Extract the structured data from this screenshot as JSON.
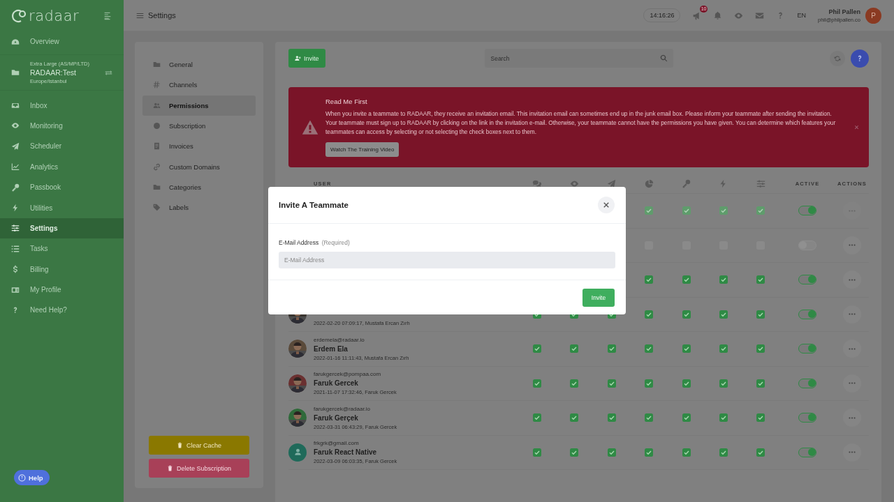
{
  "sidebar": {
    "logo": "radaar",
    "items": [
      {
        "kind": "link",
        "label": "Overview",
        "selected": false
      },
      {
        "kind": "workspace",
        "plan": "Extra Large (AS/MP/LTD)",
        "name": "RADAAR:Test",
        "timezone": "Europe/Istanbul"
      },
      {
        "kind": "link",
        "label": "Inbox",
        "selected": false
      },
      {
        "kind": "link",
        "label": "Monitoring",
        "selected": false
      },
      {
        "kind": "link",
        "label": "Scheduler",
        "selected": false
      },
      {
        "kind": "link",
        "label": "Analytics",
        "selected": false
      },
      {
        "kind": "link",
        "label": "Passbook",
        "selected": false
      },
      {
        "kind": "link",
        "label": "Utilities",
        "selected": false
      },
      {
        "kind": "link",
        "label": "Settings",
        "selected": true
      },
      {
        "kind": "link",
        "label": "Tasks",
        "selected": false
      },
      {
        "kind": "link",
        "label": "Billing",
        "selected": false
      },
      {
        "kind": "link",
        "label": "My Profile",
        "selected": false
      },
      {
        "kind": "link",
        "label": "Need Help?",
        "selected": false
      }
    ]
  },
  "topbar": {
    "title": "Settings",
    "clock": "14:16:26",
    "notification_count": "10",
    "language": "EN",
    "user": {
      "name": "Phil Pallen",
      "email": "phil@philpallen.co",
      "initial": "P"
    }
  },
  "settings_menu": {
    "items": [
      {
        "label": "General",
        "selected": false
      },
      {
        "label": "Channels",
        "selected": false
      },
      {
        "label": "Permissions",
        "selected": true
      },
      {
        "label": "Subscription",
        "selected": false
      },
      {
        "label": "Invoices",
        "selected": false
      },
      {
        "label": "Custom Domains",
        "selected": false
      },
      {
        "label": "Categories",
        "selected": false
      },
      {
        "label": "Labels",
        "selected": false
      }
    ],
    "buttons": [
      {
        "kind": "warning",
        "label": "Clear Cache"
      },
      {
        "kind": "danger",
        "label": "Delete Subscription"
      }
    ]
  },
  "main": {
    "invite_button": "Invite",
    "search": {
      "placeholder": "Search"
    },
    "notice": {
      "title": "Read Me First",
      "text": "When you invite a teammate to RADAAR, they receive an invitation email. This invitation email can sometimes end up in the junk email box. Please inform your teammate after sending the invitation. Your teammate must sign up to RADAAR by clicking on the link in the invitation e-mail. Otherwise, your teammate cannot have the permissions you have given. You can determine which features your teammates can access by selecting or not selecting the check boxes next to them.",
      "button": "Watch The Training Video"
    },
    "table": {
      "columns": [
        "USER",
        "ACTIVE",
        "ACTIONS"
      ],
      "rows": [
        {
          "permissions": [
            true,
            true,
            true,
            true
          ],
          "active": true,
          "disabled": true
        },
        {
          "permissions": [
            false,
            false,
            false,
            false
          ],
          "active": false,
          "disabled": false
        },
        {
          "permissions": [
            true,
            true,
            true,
            true
          ],
          "active": true,
          "disabled": false
        },
        {
          "meta": "2022-02-20 07:09:17, Mustafa Ercan Zırh",
          "permissions": [
            true,
            true,
            true,
            true,
            true,
            true,
            true
          ],
          "active": true,
          "disabled": false
        },
        {
          "email": "erdemela@radaar.io",
          "name": "Erdem Ela",
          "meta": "2022-01-16 11:11:43, Mustafa Ercan Zırh",
          "permissions": [
            true,
            true,
            true,
            true,
            true,
            true,
            true
          ],
          "active": true,
          "disabled": false
        },
        {
          "email": "farukgercek@pompaa.com",
          "name": "Faruk Gercek",
          "meta": "2021-11-07 17:32:46, Faruk Gercek",
          "permissions": [
            true,
            true,
            true,
            true,
            true,
            true,
            true
          ],
          "active": true,
          "disabled": false
        },
        {
          "email": "farukgercek@radaar.io",
          "name": "Faruk Gerçek",
          "meta": "2022-03-31 06:43:29, Faruk Gercek",
          "permissions": [
            true,
            true,
            true,
            true,
            true,
            true,
            true
          ],
          "active": true,
          "disabled": false
        },
        {
          "kind": "placeholder",
          "email": "frkgrk@gmail.com",
          "name": "Faruk React Native",
          "meta": "2022-03-09 06:03:35, Faruk Gercek",
          "permissions": [
            true,
            true,
            true,
            true,
            true,
            true,
            true
          ],
          "active": true,
          "disabled": false
        }
      ]
    }
  },
  "modal": {
    "title": "Invite A Teammate",
    "field": {
      "label": "E-Mail Address",
      "hint": "(Required)",
      "placeholder": "E-Mail Address"
    },
    "button": "Invite"
  },
  "help_button": "Help"
}
